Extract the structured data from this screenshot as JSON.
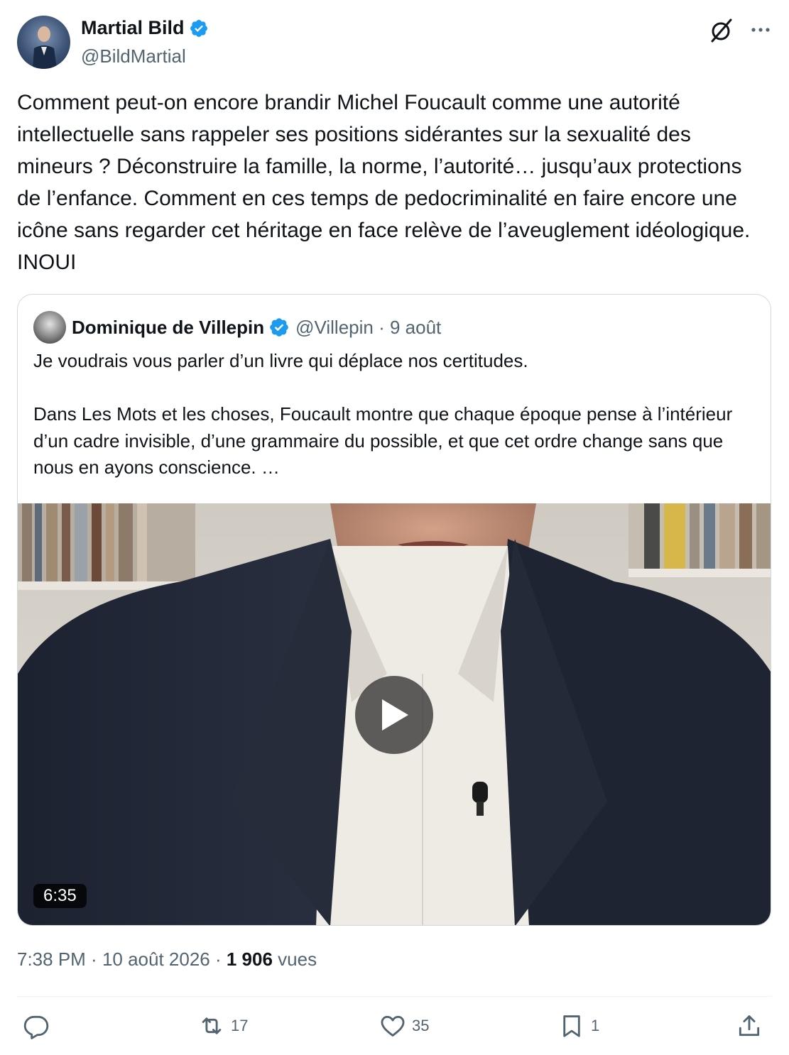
{
  "author": {
    "name": "Martial Bild",
    "handle": "@BildMartial"
  },
  "tweet": {
    "text": "Comment peut-on encore brandir Michel Foucault comme une autorité intellectuelle sans rappeler ses positions sidérantes sur la sexualité des mineurs ? Déconstruire la famille, la norme, l’autorité… jusqu’aux protections de l’enfance. Comment en ces temps de pedocriminalité en faire encore une icône sans regarder cet héritage en face relève de l’aveuglement idéologique. INOUI"
  },
  "quote": {
    "name": "Dominique de Villepin",
    "handle": "@Villepin",
    "separator": " · ",
    "date": "9 août",
    "text": "Je voudrais vous parler d’un livre qui déplace nos certitudes.\n\nDans Les Mots et les choses, Foucault montre que chaque époque pense à l’intérieur d’un cadre invisible, d’une grammaire du possible, et que cet ordre change sans que nous en ayons conscience. …",
    "video_duration": "6:35"
  },
  "meta": {
    "time": "7:38 PM",
    "separator": " · ",
    "date": "10 août 2026",
    "views_count": "1 906",
    "views_label": "vues"
  },
  "actions": {
    "reply_count": "",
    "repost_count": "17",
    "like_count": "35",
    "bookmark_count": "1"
  },
  "colors": {
    "verified": "#1d9bf0",
    "text": "#0f1419",
    "secondary": "#536471",
    "border": "#cfd9de"
  },
  "icons": [
    "verified-badge-icon",
    "grok-icon",
    "more-icon",
    "play-icon",
    "reply-icon",
    "repost-icon",
    "like-icon",
    "bookmark-icon",
    "share-icon"
  ]
}
